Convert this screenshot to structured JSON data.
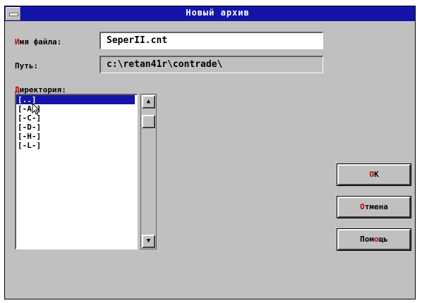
{
  "dialog": {
    "title": "Новый архив"
  },
  "filename": {
    "label_hot": "И",
    "label_rest": "мя файла:",
    "value": "SeperII.cnt"
  },
  "path": {
    "label": "Путь:",
    "value": "c:\\retan41r\\contrade\\"
  },
  "directory": {
    "label_hot": "Д",
    "label_rest": "иректория:",
    "items": [
      "[..]",
      "[-A-]",
      "[-C-]",
      "[-D-]",
      "[-H-]",
      "[-L-]"
    ],
    "selected_index": 0
  },
  "buttons": {
    "ok_hot": "О",
    "ok_rest": "К",
    "cancel_hot": "О",
    "cancel_rest": "тмена",
    "help_pre": "Пом",
    "help_hot": "о",
    "help_post": "щь"
  },
  "colors": {
    "titlebar": "#1414a8",
    "dialog_bg": "#c0c0c0",
    "hotkey": "#c00000",
    "selection": "#1414a8"
  },
  "icons": {
    "scroll_up": "scroll-up-arrow-icon",
    "scroll_down": "scroll-down-arrow-icon",
    "system_menu": "system-menu-icon",
    "pointer": "mouse-pointer-icon"
  }
}
